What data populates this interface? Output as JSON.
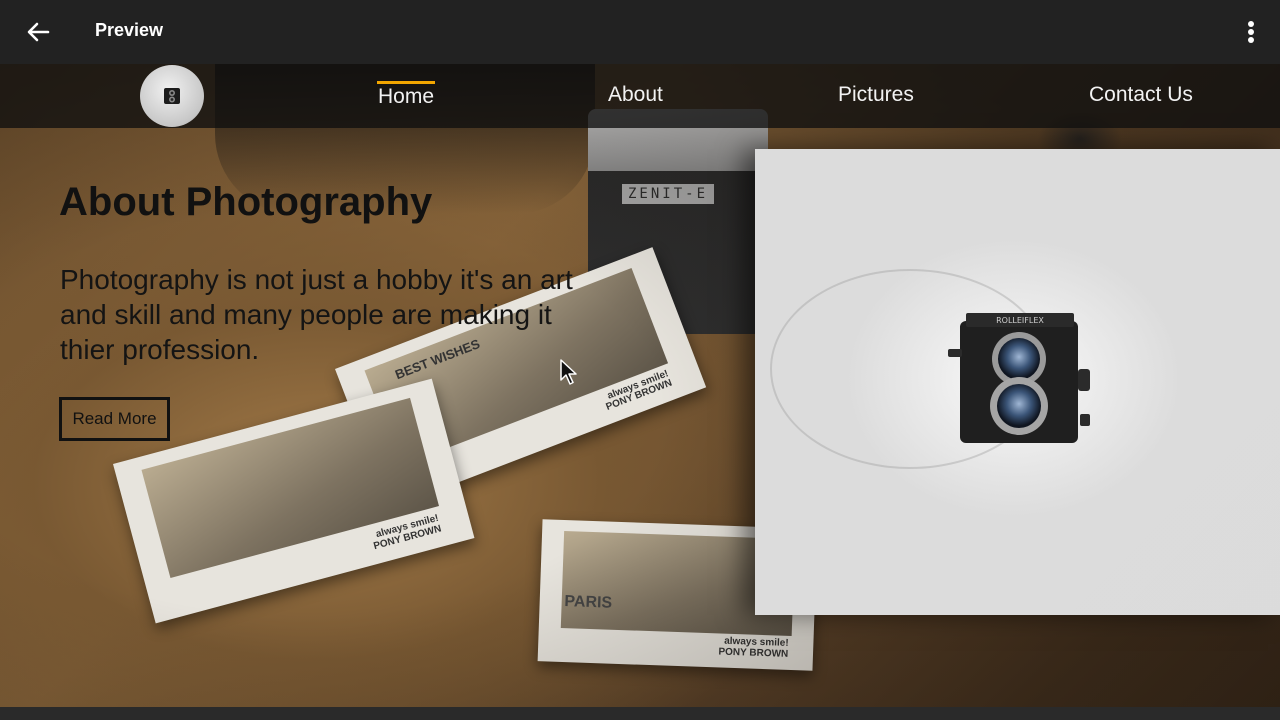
{
  "appbar": {
    "title": "Preview",
    "back_icon": "arrow-left-icon",
    "more_icon": "more-vert-icon"
  },
  "nav": {
    "logo_icon": "camera-logo-icon",
    "links": [
      "Home",
      "About",
      "Pictures",
      "Contact Us"
    ],
    "active": "Home",
    "accent_color": "#f2a600"
  },
  "hero": {
    "title": "About Photography",
    "text": "Photography is not just a hobby it's an art and skill and many people are making it thier profession.",
    "button_label": "Read More"
  },
  "decor": {
    "camera_brand": "ZENIT-E",
    "postcard_top": "BEST WISHES",
    "postcard_paris": "PARIS",
    "caption_line1": "always smile!",
    "caption_line2": "PONY BROWN",
    "tlr_brand": "ROLLEIFLEX"
  }
}
